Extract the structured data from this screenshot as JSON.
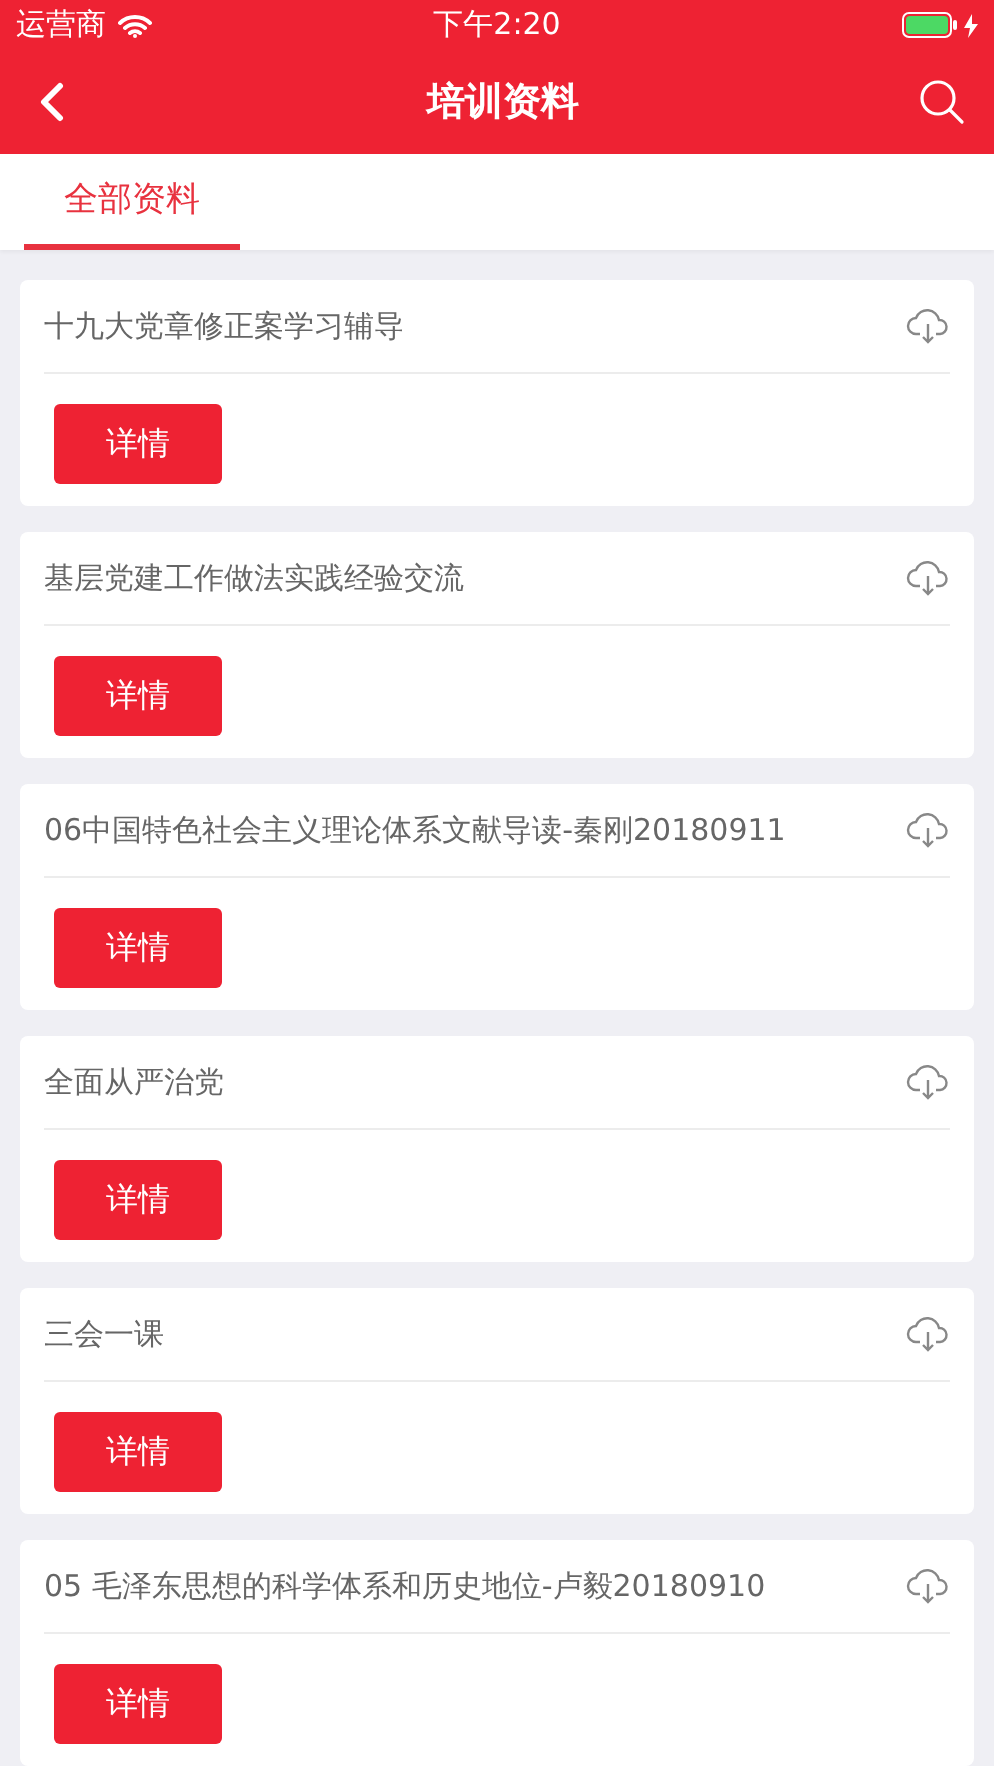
{
  "status_bar": {
    "carrier": "运营商",
    "time": "下午2:20"
  },
  "nav_bar": {
    "title": "培训资料"
  },
  "tabs": [
    {
      "label": "全部资料",
      "selected": true
    }
  ],
  "documents": [
    {
      "title": "十九大党章修正案学习辅导",
      "button": "详情"
    },
    {
      "title": "基层党建工作做法实践经验交流",
      "button": "详情"
    },
    {
      "title": "06中国特色社会主义理论体系文献导读-秦刚20180911",
      "button": "详情"
    },
    {
      "title": "全面从严治党",
      "button": "详情"
    },
    {
      "title": "三会一课",
      "button": "详情"
    },
    {
      "title": "05 毛泽东思想的科学体系和历史地位-卢毅20180910",
      "button": "详情"
    }
  ]
}
